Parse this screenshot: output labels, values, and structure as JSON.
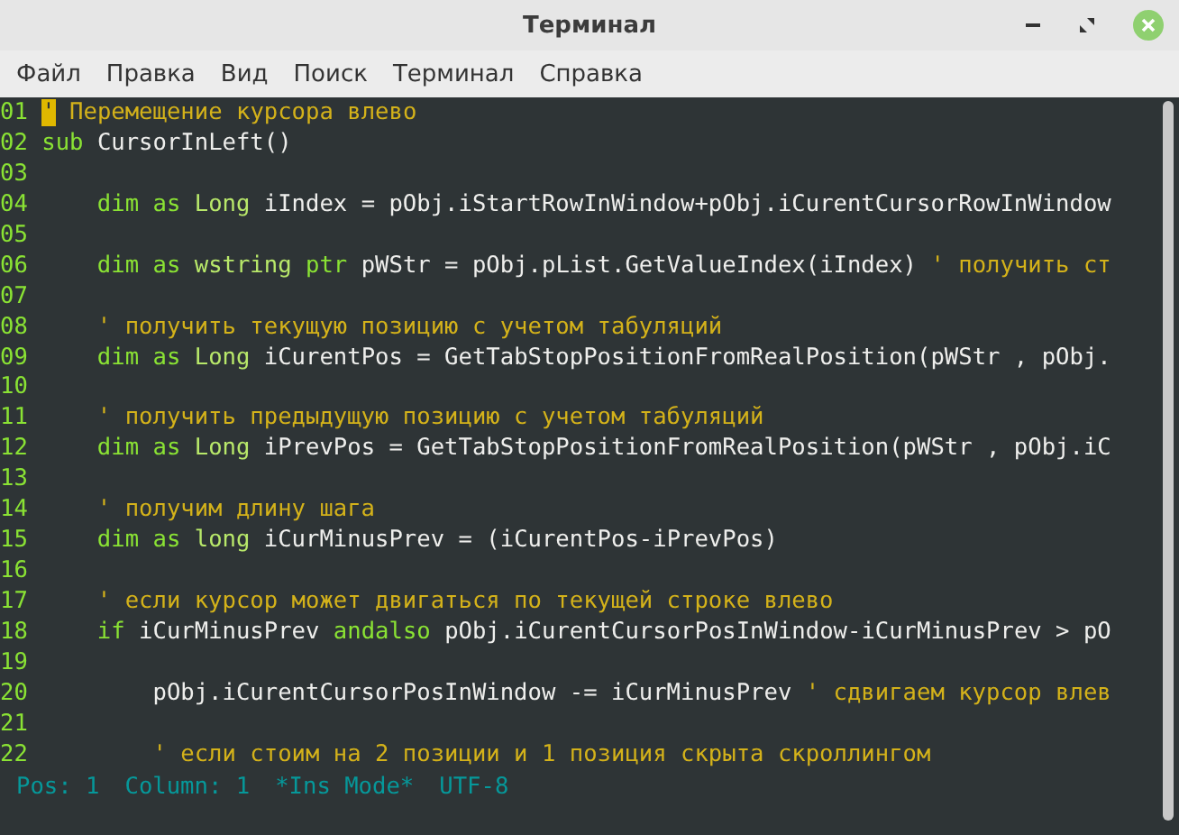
{
  "window": {
    "title": "Терминал"
  },
  "menu": [
    "Файл",
    "Правка",
    "Вид",
    "Поиск",
    "Терминал",
    "Справка"
  ],
  "editor": {
    "lines": [
      {
        "number": "01",
        "tokens": [
          {
            "kind": "cursor",
            "text": "'"
          },
          {
            "kind": "comment",
            "text": " Перемещение курсора влево"
          }
        ]
      },
      {
        "number": "02",
        "tokens": [
          {
            "kind": "keyword",
            "text": "sub"
          },
          {
            "kind": "plain",
            "text": " CursorInLeft()"
          }
        ]
      },
      {
        "number": "03"
      },
      {
        "number": "04",
        "tokens": [
          {
            "kind": "keyword",
            "text": "    dim as "
          },
          {
            "kind": "type",
            "text": "Long"
          },
          {
            "kind": "plain",
            "text": " iIndex = pObj.iStartRowInWindow+pObj.iCurentCursorRowInWindow"
          }
        ]
      },
      {
        "number": "05"
      },
      {
        "number": "06",
        "tokens": [
          {
            "kind": "keyword",
            "text": "    dim as "
          },
          {
            "kind": "type",
            "text": "wstring"
          },
          {
            "kind": "keyword",
            "text": " ptr"
          },
          {
            "kind": "plain",
            "text": " pWStr = pObj.pList.GetValueIndex(iIndex) "
          },
          {
            "kind": "comment",
            "text": "' получить ст"
          }
        ]
      },
      {
        "number": "07"
      },
      {
        "number": "08",
        "tokens": [
          {
            "kind": "comment",
            "text": "    ' получить текущую позицию с учетом табуляций"
          }
        ]
      },
      {
        "number": "09",
        "tokens": [
          {
            "kind": "keyword",
            "text": "    dim as "
          },
          {
            "kind": "type",
            "text": "Long"
          },
          {
            "kind": "plain",
            "text": " iCurentPos = GetTabStopPositionFromRealPosition(pWStr , pObj."
          }
        ]
      },
      {
        "number": "10"
      },
      {
        "number": "11",
        "tokens": [
          {
            "kind": "comment",
            "text": "    ' получить предыдущую позицию с учетом табуляций"
          }
        ]
      },
      {
        "number": "12",
        "tokens": [
          {
            "kind": "keyword",
            "text": "    dim as "
          },
          {
            "kind": "type",
            "text": "Long"
          },
          {
            "kind": "plain",
            "text": " iPrevPos = GetTabStopPositionFromRealPosition(pWStr , pObj.iC"
          }
        ]
      },
      {
        "number": "13"
      },
      {
        "number": "14",
        "tokens": [
          {
            "kind": "comment",
            "text": "    ' получим длину шага"
          }
        ]
      },
      {
        "number": "15",
        "tokens": [
          {
            "kind": "keyword",
            "text": "    dim as "
          },
          {
            "kind": "type",
            "text": "long"
          },
          {
            "kind": "plain",
            "text": " iCurMinusPrev = (iCurentPos-iPrevPos)"
          }
        ]
      },
      {
        "number": "16"
      },
      {
        "number": "17",
        "tokens": [
          {
            "kind": "comment",
            "text": "    ' если курсор может двигаться по текущей строке влево"
          }
        ]
      },
      {
        "number": "18",
        "tokens": [
          {
            "kind": "keyword",
            "text": "    if"
          },
          {
            "kind": "plain",
            "text": " iCurMinusPrev "
          },
          {
            "kind": "keyword",
            "text": "andalso"
          },
          {
            "kind": "plain",
            "text": " pObj.iCurentCursorPosInWindow-iCurMinusPrev > pO"
          }
        ]
      },
      {
        "number": "19"
      },
      {
        "number": "20",
        "tokens": [
          {
            "kind": "plain",
            "text": "        pObj.iCurentCursorPosInWindow -= iCurMinusPrev "
          },
          {
            "kind": "comment",
            "text": "' сдвигаем курсор влев"
          }
        ]
      },
      {
        "number": "21"
      },
      {
        "number": "22",
        "tokens": [
          {
            "kind": "comment",
            "text": "        ' если стоим на 2 позиции и 1 позиция скрыта скроллингом"
          }
        ]
      }
    ],
    "status": [
      "Pos: 1",
      "Column: 1",
      "*Ins Mode*",
      "UTF-8"
    ]
  }
}
